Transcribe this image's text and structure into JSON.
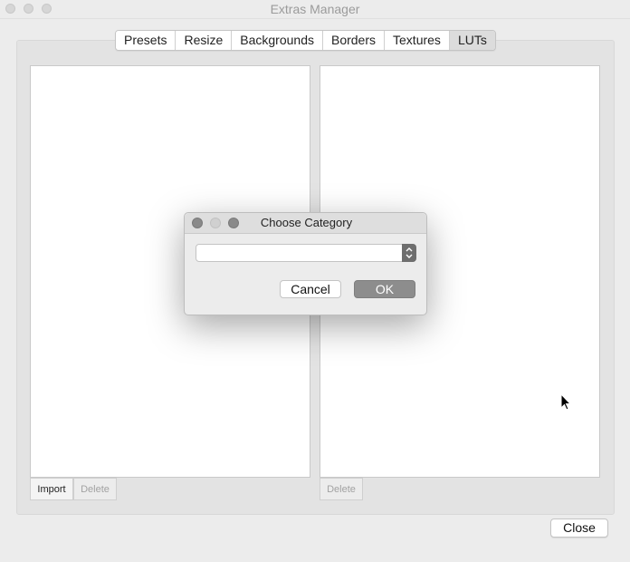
{
  "window": {
    "title": "Extras Manager"
  },
  "tabs": [
    {
      "label": "Presets"
    },
    {
      "label": "Resize"
    },
    {
      "label": "Backgrounds"
    },
    {
      "label": "Borders"
    },
    {
      "label": "Textures"
    },
    {
      "label": "LUTs"
    }
  ],
  "left_pane": {
    "import_label": "Import",
    "delete_label": "Delete"
  },
  "right_pane": {
    "delete_label": "Delete"
  },
  "footer": {
    "close_label": "Close"
  },
  "dialog": {
    "title": "Choose Category",
    "category_value": "",
    "cancel_label": "Cancel",
    "ok_label": "OK"
  },
  "colors": {
    "window_bg": "#ececec",
    "panel_bg": "#e3e3e3",
    "ok_button": "#8d8d8d",
    "active_tab": "#dcdcdc"
  }
}
